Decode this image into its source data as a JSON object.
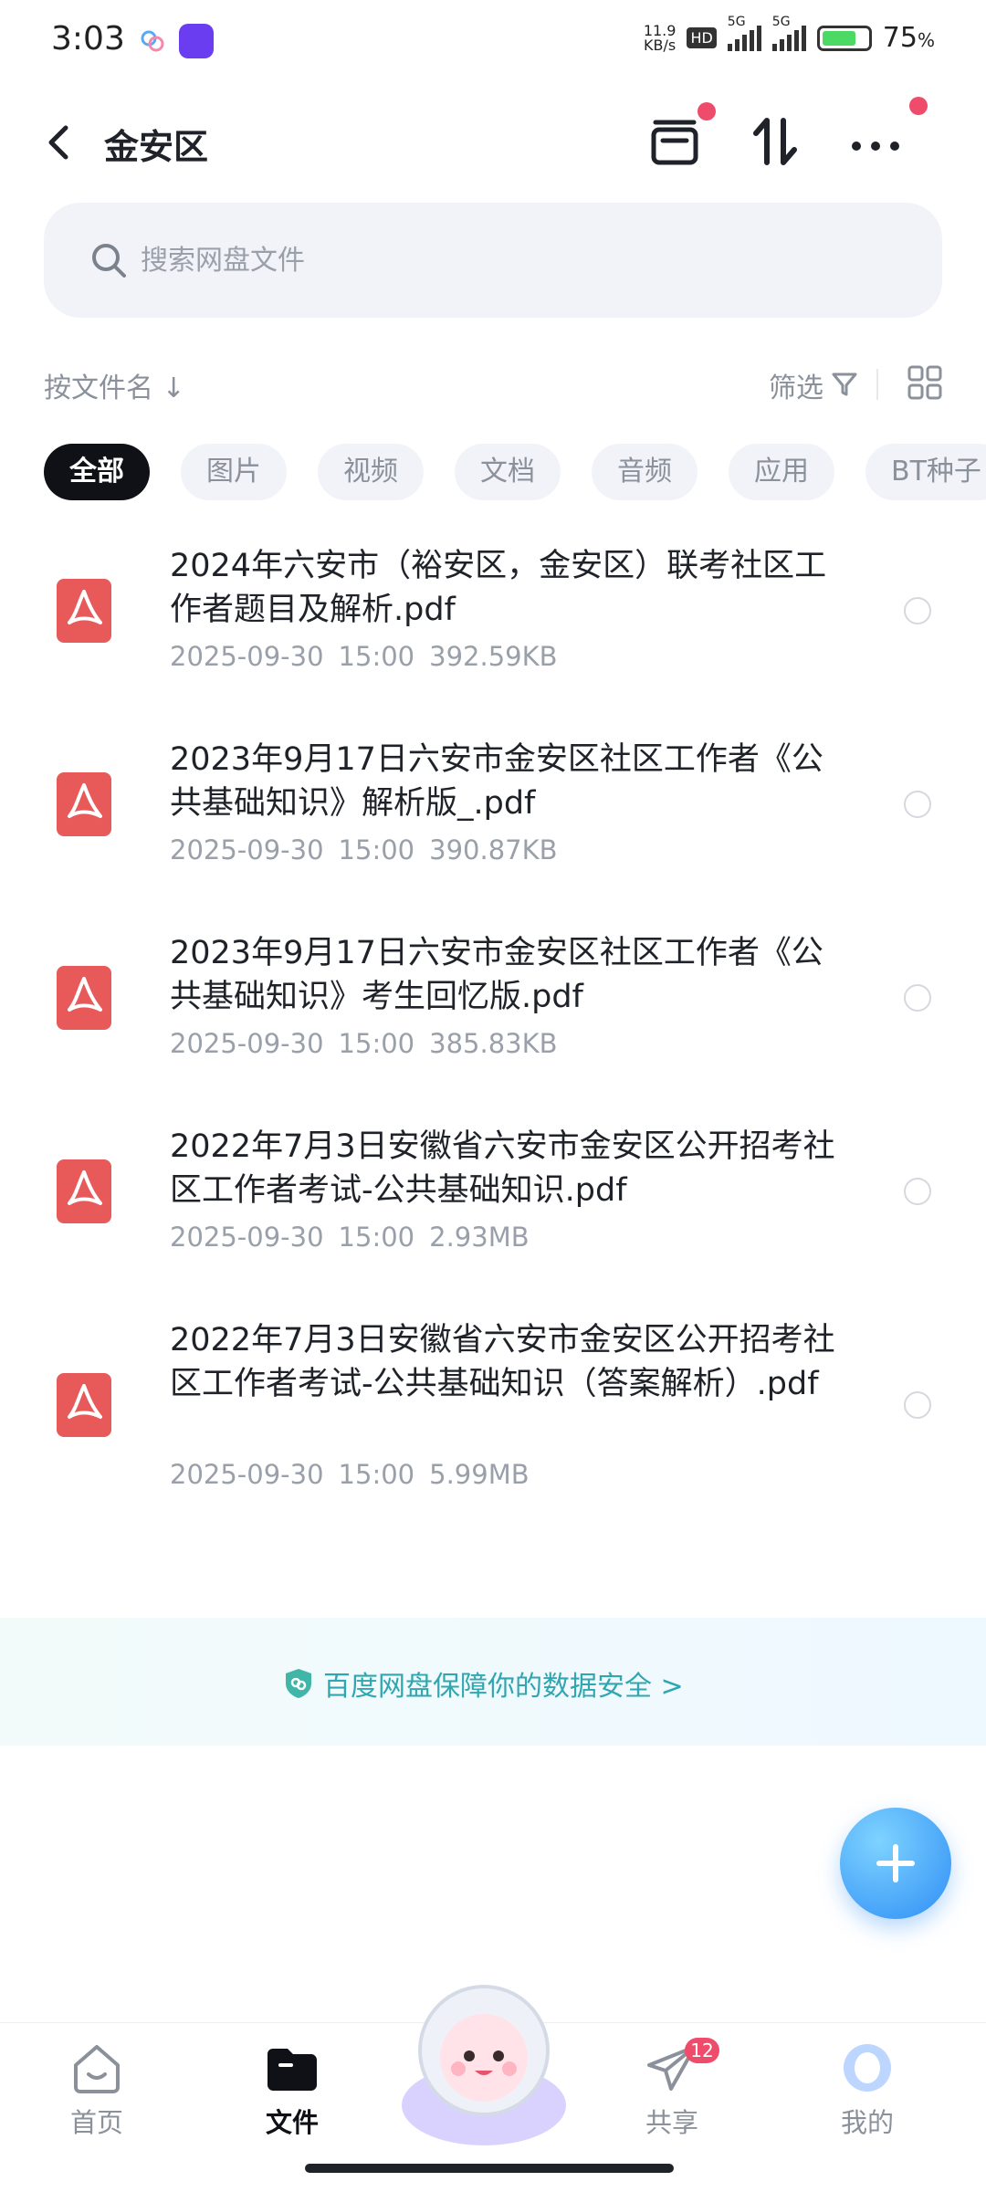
{
  "status_bar": {
    "time": "3:03",
    "net_speed_value": "11.9",
    "net_speed_unit": "KB/s",
    "hd": "HD",
    "sim1": "5G",
    "sim2": "5G",
    "battery_pct": "75",
    "battery_pct_unit": "%",
    "battery_level": 0.75
  },
  "header": {
    "title": "金安区"
  },
  "search": {
    "placeholder": "搜索网盘文件"
  },
  "sort": {
    "label": "按文件名 ↓",
    "filter_label": "筛选"
  },
  "chips": [
    "全部",
    "图片",
    "视频",
    "文档",
    "音频",
    "应用",
    "BT种子"
  ],
  "files": [
    {
      "name": "2024年六安市（裕安区，金安区）联考社区工作者题目及解析.pdf",
      "date": "2025-09-30",
      "time": "15:00",
      "size": "392.59KB"
    },
    {
      "name": "2023年9月17日六安市金安区社区工作者《公共基础知识》解析版_.pdf",
      "date": "2025-09-30",
      "time": "15:00",
      "size": "390.87KB"
    },
    {
      "name": "2023年9月17日六安市金安区社区工作者《公共基础知识》考生回忆版.pdf",
      "date": "2025-09-30",
      "time": "15:00",
      "size": "385.83KB"
    },
    {
      "name": "2022年7月3日安徽省六安市金安区公开招考社区工作者考试-公共基础知识.pdf",
      "date": "2025-09-30",
      "time": "15:00",
      "size": "2.93MB"
    },
    {
      "name": "2022年7月3日安徽省六安市金安区公开招考社区工作者考试-公共基础知识（答案解析）.pdf",
      "date": "2025-09-30",
      "time": "15:00",
      "size": "5.99MB"
    }
  ],
  "safety_banner": {
    "text": "百度网盘保障你的数据安全 >"
  },
  "bottom_nav": {
    "home": "首页",
    "files": "文件",
    "share": "共享",
    "share_badge": "12",
    "mine": "我的"
  },
  "colors": {
    "accent": "#2f8ef5",
    "pdf_red": "#e85a5a",
    "badge": "#ef4b6b",
    "safety_text": "#2fa6b0"
  }
}
